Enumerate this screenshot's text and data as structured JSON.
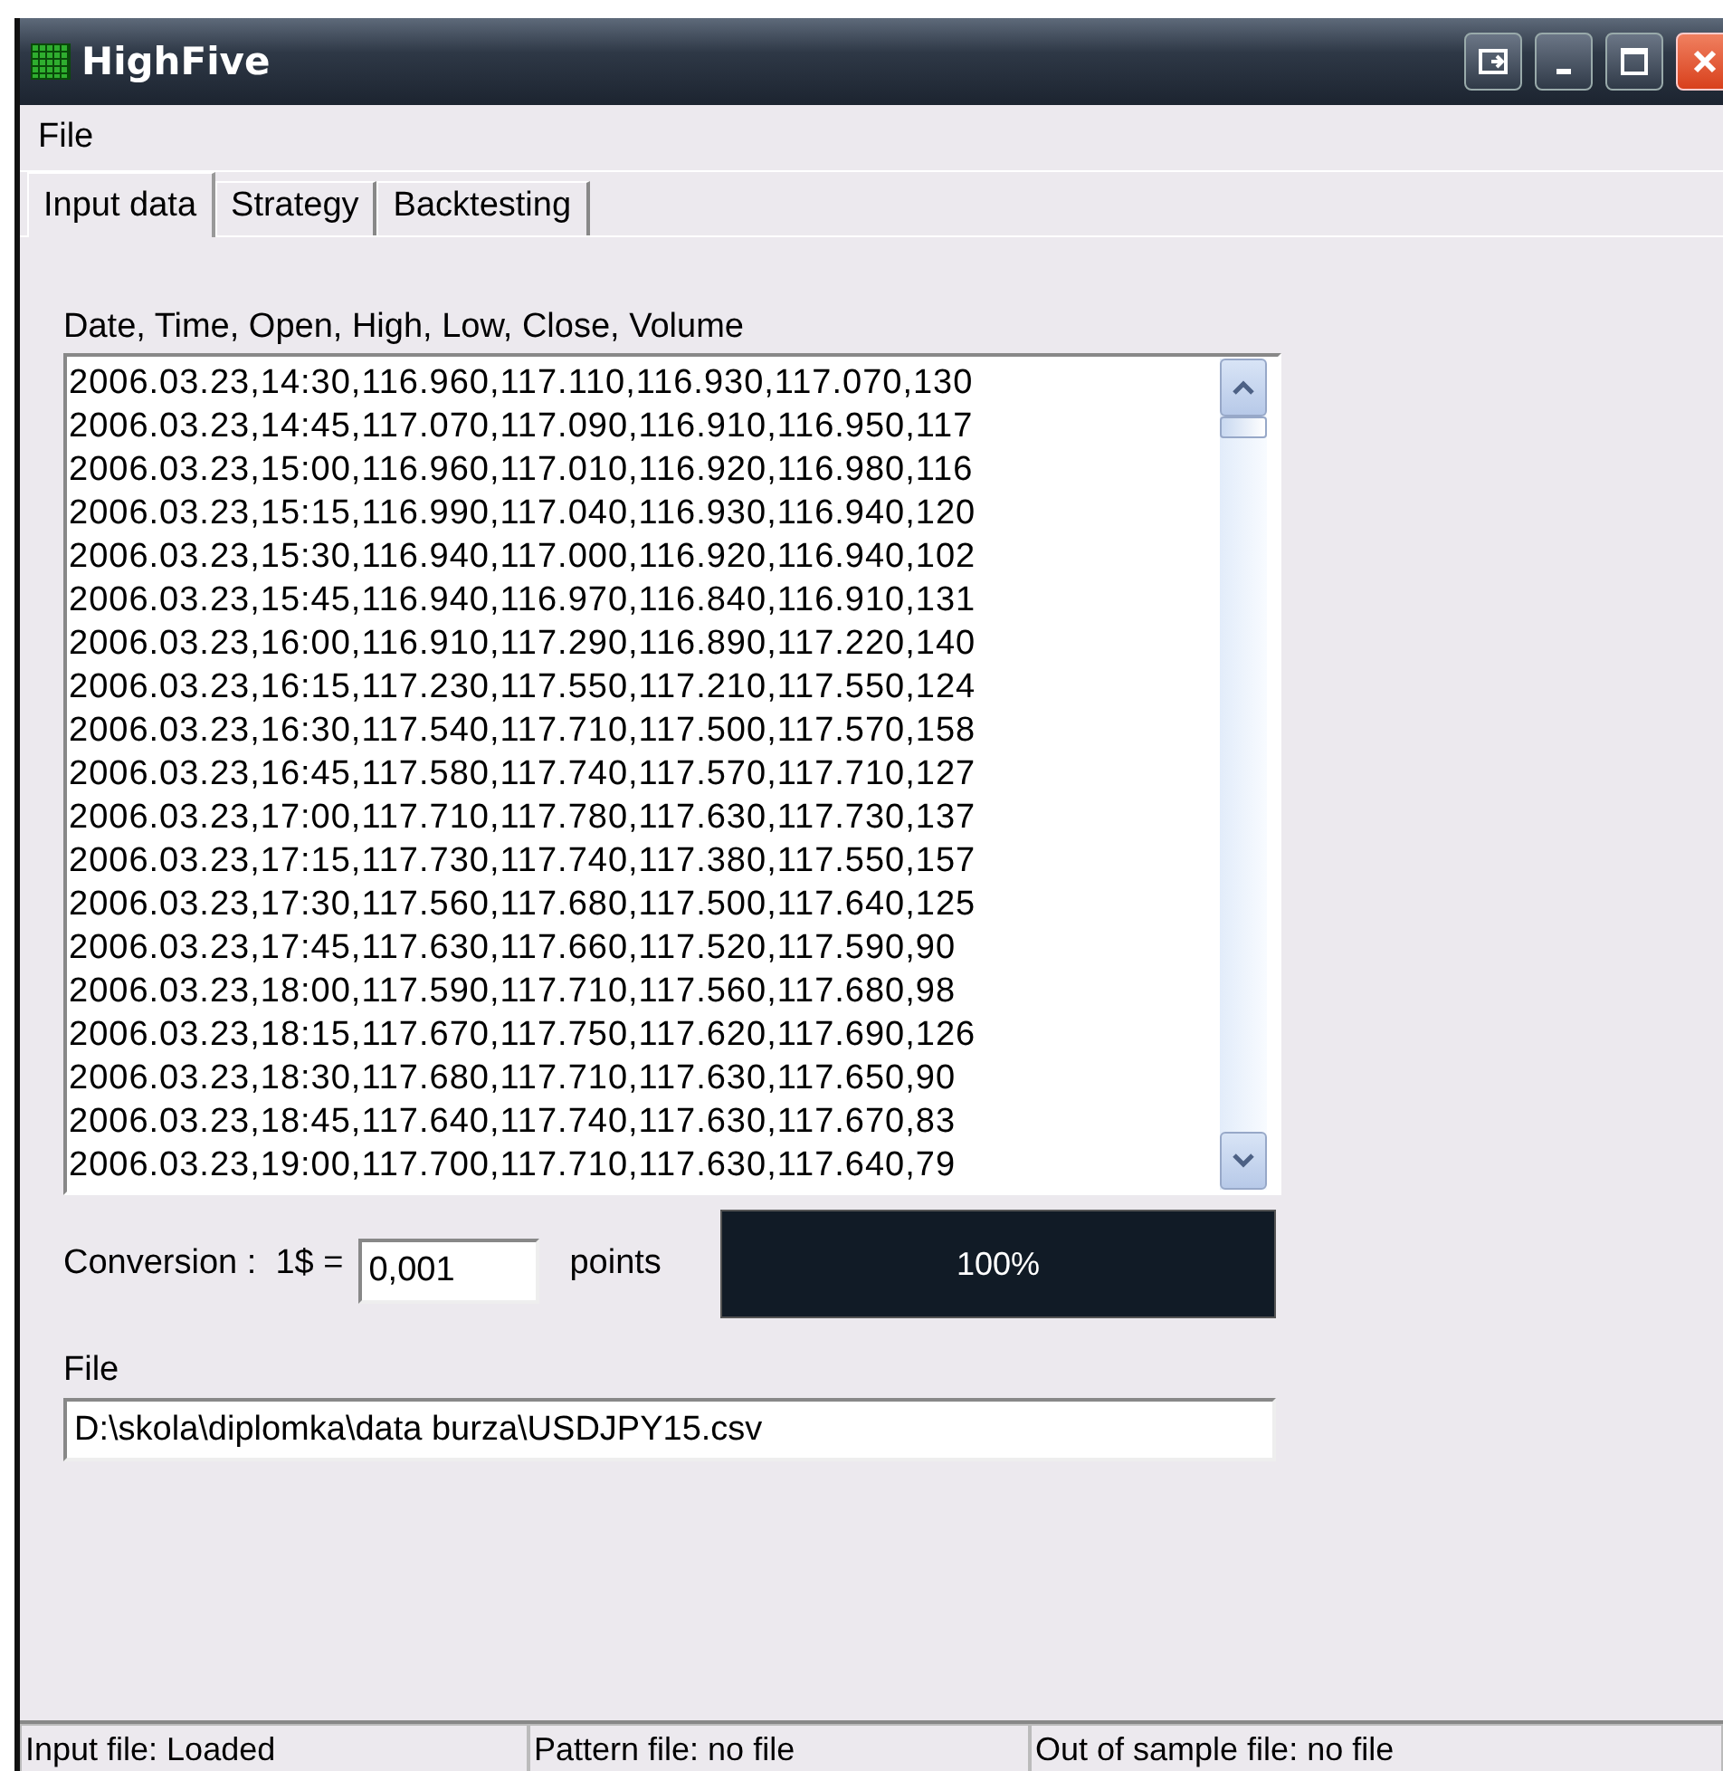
{
  "window": {
    "title": "HighFive"
  },
  "menu": [
    "File"
  ],
  "tabs": [
    {
      "label": "Input data",
      "selected": true
    },
    {
      "label": "Strategy",
      "selected": false
    },
    {
      "label": "Backtesting",
      "selected": false
    }
  ],
  "data_label": "Date, Time, Open, High, Low, Close, Volume",
  "data_rows": [
    "2006.03.23,14:30,116.960,117.110,116.930,117.070,130",
    "2006.03.23,14:45,117.070,117.090,116.910,116.950,117",
    "2006.03.23,15:00,116.960,117.010,116.920,116.980,116",
    "2006.03.23,15:15,116.990,117.040,116.930,116.940,120",
    "2006.03.23,15:30,116.940,117.000,116.920,116.940,102",
    "2006.03.23,15:45,116.940,116.970,116.840,116.910,131",
    "2006.03.23,16:00,116.910,117.290,116.890,117.220,140",
    "2006.03.23,16:15,117.230,117.550,117.210,117.550,124",
    "2006.03.23,16:30,117.540,117.710,117.500,117.570,158",
    "2006.03.23,16:45,117.580,117.740,117.570,117.710,127",
    "2006.03.23,17:00,117.710,117.780,117.630,117.730,137",
    "2006.03.23,17:15,117.730,117.740,117.380,117.550,157",
    "2006.03.23,17:30,117.560,117.680,117.500,117.640,125",
    "2006.03.23,17:45,117.630,117.660,117.520,117.590,90",
    "2006.03.23,18:00,117.590,117.710,117.560,117.680,98",
    "2006.03.23,18:15,117.670,117.750,117.620,117.690,126",
    "2006.03.23,18:30,117.680,117.710,117.630,117.650,90",
    "2006.03.23,18:45,117.640,117.740,117.630,117.670,83",
    "2006.03.23,19:00,117.700,117.710,117.630,117.640,79"
  ],
  "conversion": {
    "label": "Conversion :  1$ =",
    "value": "0,001",
    "unit": "points"
  },
  "progress": {
    "level": 1,
    "text": "100%"
  },
  "file": {
    "label": "File",
    "value": "D:\\skola\\diplomka\\data burza\\USDJPY15.csv"
  },
  "status_bar": [
    "Input file: Loaded",
    "Pattern file: no file",
    "Out of sample file: no file"
  ]
}
